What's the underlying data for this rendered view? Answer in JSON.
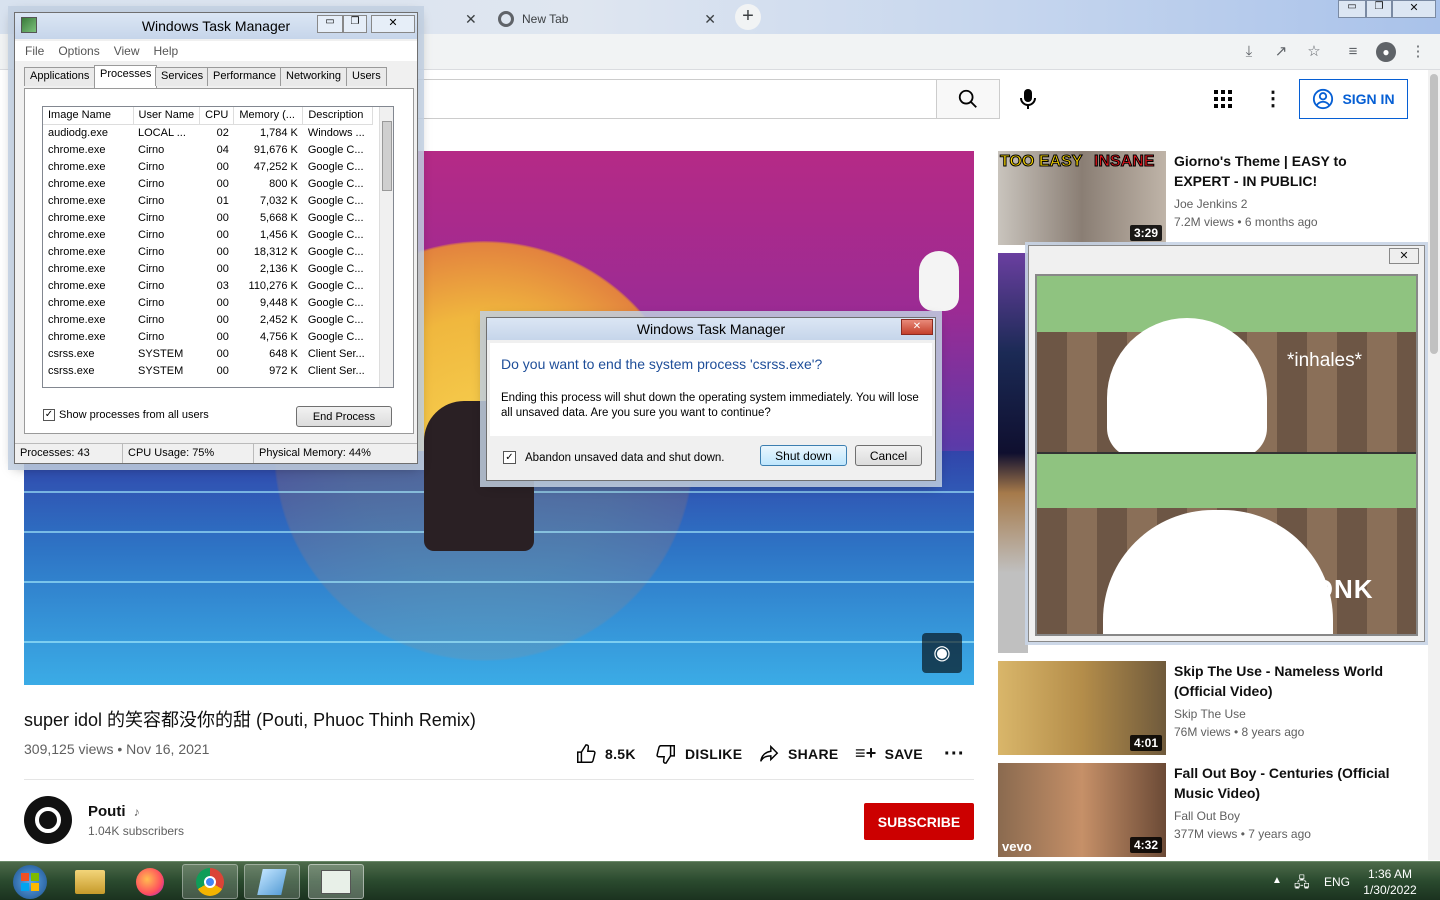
{
  "browser": {
    "tab_new": "New Tab",
    "search_placeholder": "",
    "sign_in": "SIGN IN"
  },
  "video": {
    "title": "super idol 的笑容都没你的甜 (Pouti, Phuoc Thinh Remix)",
    "meta": "309,125 views • Nov 16, 2021",
    "like": "8.5K",
    "dislike": "DISLIKE",
    "share": "SHARE",
    "save": "SAVE",
    "channel": "Pouti",
    "subscribers": "1.04K subscribers",
    "subscribe": "SUBSCRIBE"
  },
  "recommendations": [
    {
      "title": "Giorno's Theme | EASY to EXPERT - IN PUBLIC!",
      "channel": "Joe Jenkins 2",
      "meta": "7.2M views • 6 months ago",
      "duration": "3:29",
      "thumb_text_left": "TOO EASY",
      "thumb_text_right": "INSANE"
    },
    {
      "title": "Skip The Use - Nameless World (Official Video)",
      "channel": "Skip The Use",
      "meta": "76M views • 8 years ago",
      "duration": "4:01"
    },
    {
      "title": "Fall Out Boy - Centuries (Official Music Video)",
      "channel": "Fall Out Boy",
      "meta": "377M views • 7 years ago",
      "duration": "4:32",
      "badge": "vevo"
    }
  ],
  "meme": {
    "top_text": "*inhales*",
    "bottom_text": "HONK"
  },
  "taskmgr": {
    "title": "Windows Task Manager",
    "menu": [
      "File",
      "Options",
      "View",
      "Help"
    ],
    "tabs": [
      "Applications",
      "Processes",
      "Services",
      "Performance",
      "Networking",
      "Users"
    ],
    "columns": [
      "Image Name",
      "User Name",
      "CPU",
      "Memory (...",
      "Description"
    ],
    "rows": [
      [
        "audiodg.exe",
        "LOCAL ...",
        "02",
        "1,784 K",
        "Windows ..."
      ],
      [
        "chrome.exe",
        "Cirno",
        "04",
        "91,676 K",
        "Google C..."
      ],
      [
        "chrome.exe",
        "Cirno",
        "00",
        "47,252 K",
        "Google C..."
      ],
      [
        "chrome.exe",
        "Cirno",
        "00",
        "800 K",
        "Google C..."
      ],
      [
        "chrome.exe",
        "Cirno",
        "01",
        "7,032 K",
        "Google C..."
      ],
      [
        "chrome.exe",
        "Cirno",
        "00",
        "5,668 K",
        "Google C..."
      ],
      [
        "chrome.exe",
        "Cirno",
        "00",
        "1,456 K",
        "Google C..."
      ],
      [
        "chrome.exe",
        "Cirno",
        "00",
        "18,312 K",
        "Google C..."
      ],
      [
        "chrome.exe",
        "Cirno",
        "00",
        "2,136 K",
        "Google C..."
      ],
      [
        "chrome.exe",
        "Cirno",
        "03",
        "110,276 K",
        "Google C..."
      ],
      [
        "chrome.exe",
        "Cirno",
        "00",
        "9,448 K",
        "Google C..."
      ],
      [
        "chrome.exe",
        "Cirno",
        "00",
        "2,452 K",
        "Google C..."
      ],
      [
        "chrome.exe",
        "Cirno",
        "00",
        "4,756 K",
        "Google C..."
      ],
      [
        "csrss.exe",
        "SYSTEM",
        "00",
        "648 K",
        "Client Ser..."
      ],
      [
        "csrss.exe",
        "SYSTEM",
        "00",
        "972 K",
        "Client Ser..."
      ]
    ],
    "show_all": "Show processes from all users",
    "end_process": "End Process",
    "status_processes": "Processes: 43",
    "status_cpu": "CPU Usage: 75%",
    "status_memory": "Physical Memory: 44%"
  },
  "dialog": {
    "title": "Windows Task Manager",
    "heading": "Do you want to end the system process 'csrss.exe'?",
    "body": "Ending this process will shut down the operating system immediately.  You will lose all unsaved data.  Are you sure you want to continue?",
    "checkbox": "Abandon unsaved data and shut down.",
    "shutdown": "Shut down",
    "cancel": "Cancel"
  },
  "taskbar": {
    "lang": "ENG",
    "time": "1:36 AM",
    "date": "1/30/2022"
  },
  "colors": {
    "subscribe": "#cc0000",
    "youtube_blue": "#065fd4",
    "dialog_heading": "#1e4e99"
  }
}
